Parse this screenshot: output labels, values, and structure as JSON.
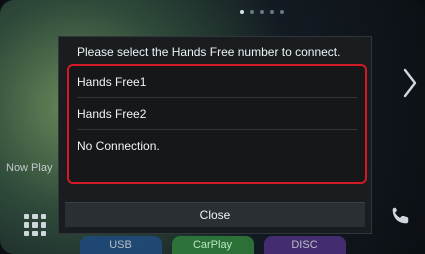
{
  "dialog": {
    "title": "Please select the Hands Free number to connect.",
    "options": [
      "Hands Free1",
      "Hands Free2",
      "No Connection."
    ],
    "close_label": "Close"
  },
  "background": {
    "now_playing_label": "Now Play",
    "bottom_tabs": [
      "USB",
      "CarPlay",
      "DISC"
    ]
  },
  "colors": {
    "highlight_border": "#d11a25",
    "dialog_bg": "#1a1d20"
  },
  "icons": {
    "right": "chevron-right-icon",
    "menu": "grid-menu-icon",
    "phone": "phone-icon"
  }
}
